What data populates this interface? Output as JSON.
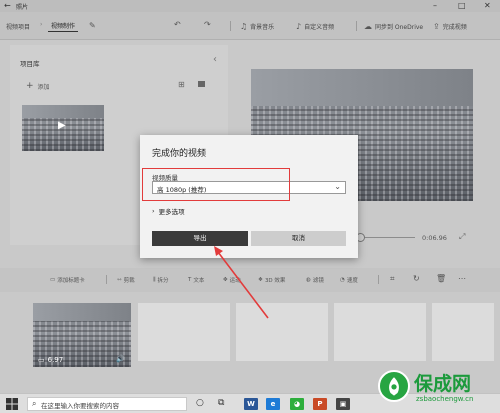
{
  "window": {
    "title": "照片"
  },
  "toolbar": {
    "breadcrumb_root": "视频项目",
    "active_tab": "视频制作",
    "items": [
      {
        "icon": "music-note-icon",
        "label": "背景音乐"
      },
      {
        "icon": "audio-wave-icon",
        "label": "自定义音频"
      },
      {
        "icon": "cloud-sync-icon",
        "label": "同步到 OneDrive"
      },
      {
        "icon": "export-icon",
        "label": "完成视频"
      }
    ]
  },
  "library": {
    "title": "项目库",
    "add_label": "添加"
  },
  "preview": {
    "current_time": "0:06.96"
  },
  "dialog": {
    "title": "完成你的视频",
    "quality_label": "视频质量",
    "quality_value": "高 1080p (推荐)",
    "more_options": "更多选项",
    "export_label": "导出",
    "cancel_label": "取消"
  },
  "storyboard_toolbar": [
    {
      "icon": "title-card-icon",
      "label": "添加标题卡"
    },
    {
      "icon": "trim-icon",
      "label": "剪裁"
    },
    {
      "icon": "split-icon",
      "label": "拆分"
    },
    {
      "icon": "text-icon",
      "label": "文本"
    },
    {
      "icon": "motion-icon",
      "label": "运动"
    },
    {
      "icon": "3d-effects-icon",
      "label": "3D 效果"
    },
    {
      "icon": "filters-icon",
      "label": "滤镜"
    },
    {
      "icon": "speed-icon",
      "label": "速度"
    }
  ],
  "clip": {
    "duration": "6.97"
  },
  "taskbar": {
    "search_placeholder": "在这里输入你要搜索的内容"
  },
  "watermark": {
    "text": "保成网",
    "url": "zsbaochengw.cn"
  },
  "colors": {
    "annotation": "#e23b3b",
    "primary_button": "#3a3a3a",
    "watermark_green": "#1c9a3c"
  }
}
